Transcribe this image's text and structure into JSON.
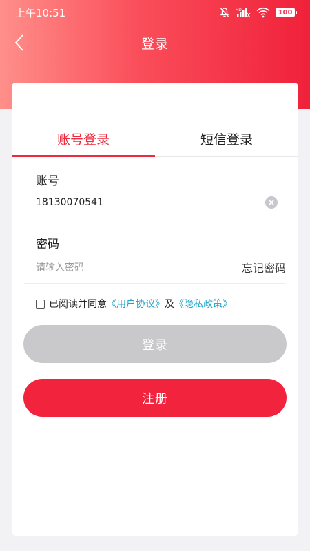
{
  "status_bar": {
    "time": "上午10:51",
    "hd_label": "HD",
    "battery": "100"
  },
  "nav": {
    "title": "登录"
  },
  "tabs": [
    {
      "label": "账号登录",
      "active": true
    },
    {
      "label": "短信登录",
      "active": false
    }
  ],
  "account": {
    "label": "账号",
    "value": "18130070541"
  },
  "password": {
    "label": "密码",
    "placeholder": "请输入密码",
    "forgot_label": "忘记密码"
  },
  "agreement": {
    "prefix": "已阅读并同意",
    "user_agreement": "《用户协议》",
    "conjunction": "及",
    "privacy_policy": "《隐私政策》",
    "checked": false
  },
  "buttons": {
    "login": "登录",
    "register": "注册"
  },
  "colors": {
    "accent": "#ee2b3e",
    "link": "#1fa4c8",
    "disabled_button": "#c9c9cc"
  }
}
